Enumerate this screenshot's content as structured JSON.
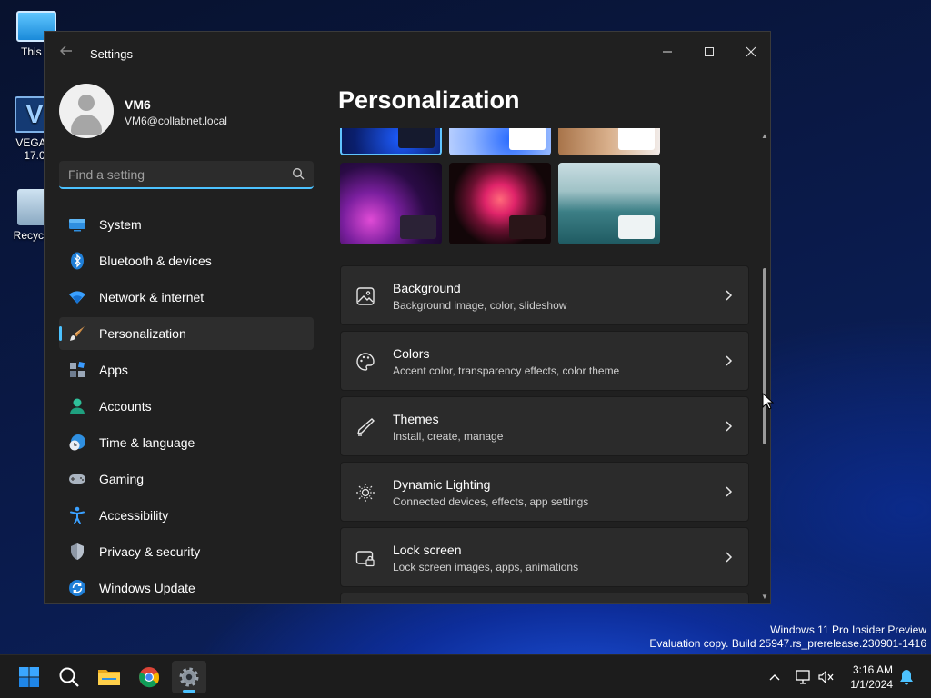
{
  "desktop": {
    "icons": [
      {
        "label": "This P"
      },
      {
        "label": "VEGAS\n17.0",
        "glyph": "V"
      },
      {
        "label": "Recycle"
      }
    ]
  },
  "window": {
    "title": "Settings",
    "controls": {
      "minimize": "─",
      "maximize": "☐",
      "close": "✕"
    }
  },
  "user": {
    "name": "VM6",
    "email": "VM6@collabnet.local"
  },
  "search": {
    "placeholder": "Find a setting"
  },
  "nav": {
    "items": [
      {
        "label": "System",
        "icon": "system-icon"
      },
      {
        "label": "Bluetooth & devices",
        "icon": "bluetooth-icon"
      },
      {
        "label": "Network & internet",
        "icon": "wifi-icon"
      },
      {
        "label": "Personalization",
        "icon": "brush-icon",
        "active": true
      },
      {
        "label": "Apps",
        "icon": "apps-icon"
      },
      {
        "label": "Accounts",
        "icon": "accounts-icon"
      },
      {
        "label": "Time & language",
        "icon": "clock-globe-icon"
      },
      {
        "label": "Gaming",
        "icon": "gamepad-icon"
      },
      {
        "label": "Accessibility",
        "icon": "accessibility-icon"
      },
      {
        "label": "Privacy & security",
        "icon": "shield-icon"
      },
      {
        "label": "Windows Update",
        "icon": "update-icon"
      }
    ]
  },
  "page": {
    "title": "Personalization",
    "cards": [
      {
        "title": "Background",
        "subtitle": "Background image, color, slideshow",
        "icon": "image-icon"
      },
      {
        "title": "Colors",
        "subtitle": "Accent color, transparency effects, color theme",
        "icon": "palette-icon"
      },
      {
        "title": "Themes",
        "subtitle": "Install, create, manage",
        "icon": "pen-icon"
      },
      {
        "title": "Dynamic Lighting",
        "subtitle": "Connected devices, effects, app settings",
        "icon": "lighting-icon"
      },
      {
        "title": "Lock screen",
        "subtitle": "Lock screen images, apps, animations",
        "icon": "lock-screen-icon"
      }
    ]
  },
  "watermark": {
    "line1": "Windows 11 Pro Insider Preview",
    "line2": "Evaluation copy. Build 25947.rs_prerelease.230901-1416"
  },
  "taskbar": {
    "time": "3:16 AM",
    "date": "1/1/2024"
  },
  "colors": {
    "accent": "#4cc2ff",
    "window_bg": "#202020",
    "card_bg": "#2b2b2b"
  }
}
